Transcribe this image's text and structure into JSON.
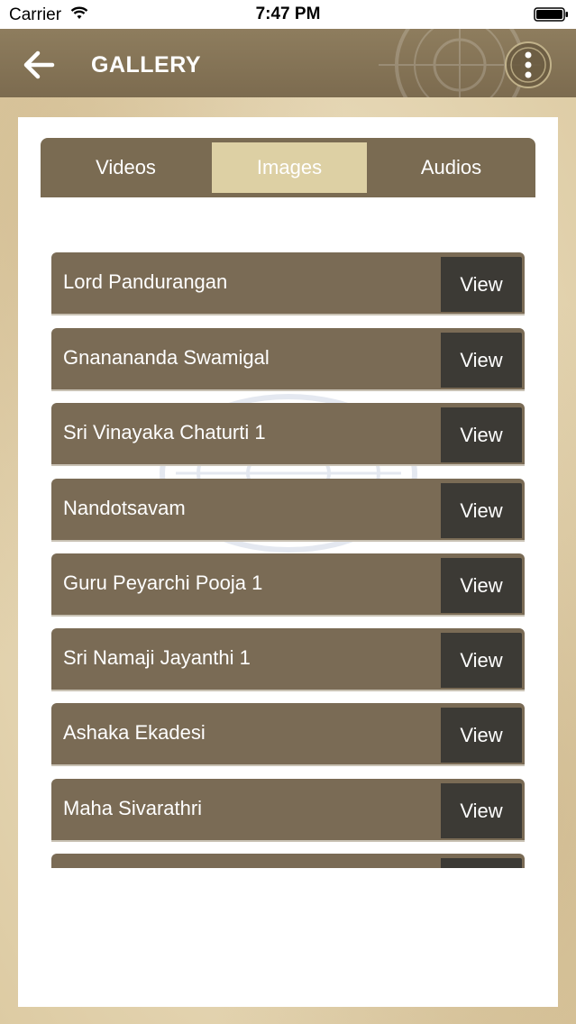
{
  "status_bar": {
    "carrier": "Carrier",
    "time": "7:47 PM"
  },
  "header": {
    "title": "GALLERY",
    "back_icon": "arrow-left-icon",
    "menu_icon": "more-vertical-icon"
  },
  "tabs": [
    {
      "label": "Videos",
      "selected": false
    },
    {
      "label": "Images",
      "selected": true
    },
    {
      "label": "Audios",
      "selected": false
    }
  ],
  "gallery_items": [
    {
      "title": "Lord Pandurangan",
      "action": "View"
    },
    {
      "title": "Gnanananda Swamigal",
      "action": "View"
    },
    {
      "title": "Sri Vinayaka Chaturti 1",
      "action": "View"
    },
    {
      "title": "Nandotsavam",
      "action": "View"
    },
    {
      "title": "Guru Peyarchi Pooja 1",
      "action": "View"
    },
    {
      "title": "Sri Namaji Jayanthi 1",
      "action": "View"
    },
    {
      "title": "Ashaka Ekadesi",
      "action": "View"
    },
    {
      "title": "Maha Sivarathri",
      "action": "View"
    },
    {
      "title": "",
      "action": ""
    }
  ],
  "colors": {
    "header_bg": "#8e7d5e",
    "tab_bg": "#7a6b52",
    "tab_selected_bg": "#ddd0a4",
    "item_bg": "#7a6b55",
    "view_button_bg": "#3c3a35"
  }
}
